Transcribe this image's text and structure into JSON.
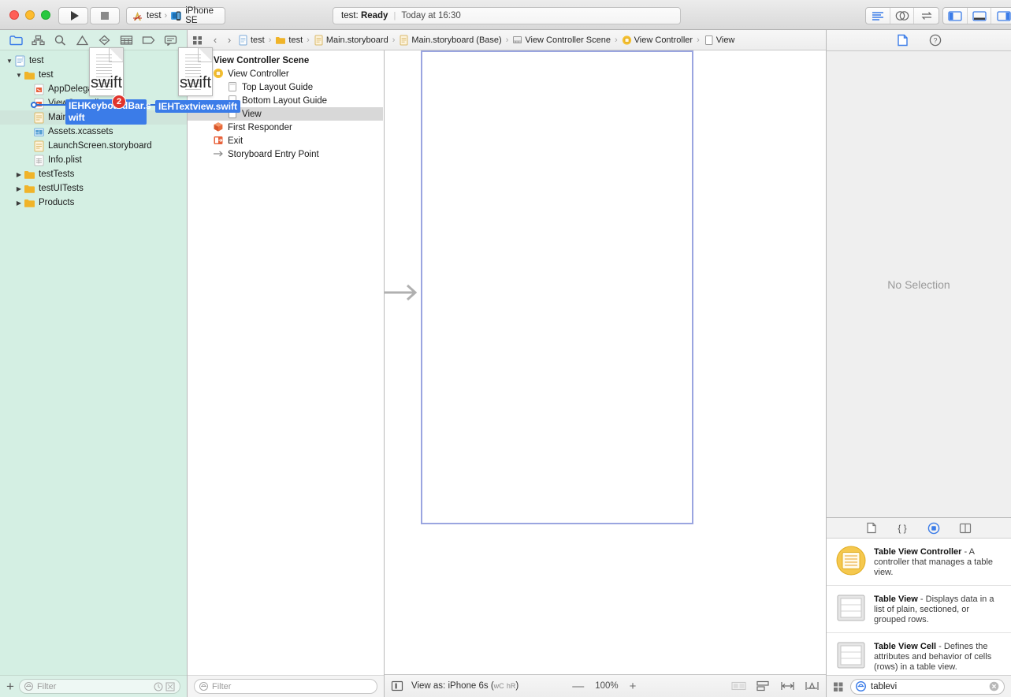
{
  "window": {
    "traffic_lights": [
      "close",
      "minimize",
      "zoom"
    ]
  },
  "toolbar": {
    "run_label": "Run",
    "stop_label": "Stop",
    "scheme_project": "test",
    "scheme_destination": "iPhone SE",
    "activity_prefix": "test:",
    "activity_status": "Ready",
    "activity_divider": "|",
    "activity_date": "Today at 16:30",
    "editor_modes": [
      "standard-editor",
      "assistant-editor",
      "version-editor"
    ],
    "panel_toggles": [
      "navigator-toggle",
      "debug-area-toggle",
      "utilities-toggle"
    ]
  },
  "navigator": {
    "tabs": [
      {
        "name": "project-navigator",
        "selected": true
      },
      {
        "name": "source-control-navigator",
        "selected": false
      },
      {
        "name": "symbol-navigator",
        "selected": false
      },
      {
        "name": "issue-navigator",
        "selected": false
      },
      {
        "name": "test-navigator",
        "selected": false
      },
      {
        "name": "debug-navigator",
        "selected": false
      },
      {
        "name": "breakpoint-navigator",
        "selected": false
      },
      {
        "name": "report-navigator",
        "selected": false
      }
    ],
    "tree": [
      {
        "label": "test",
        "indent": 0,
        "icon": "project",
        "twist": "open"
      },
      {
        "label": "test",
        "indent": 1,
        "icon": "folder",
        "twist": "open"
      },
      {
        "label": "AppDelegate.swift",
        "indent": 2,
        "icon": "swift",
        "twist": "none"
      },
      {
        "label": "ViewController.swift",
        "indent": 2,
        "icon": "swift",
        "twist": "none"
      },
      {
        "label": "Main.storyboard",
        "indent": 2,
        "icon": "storyboard",
        "twist": "none",
        "highlighted": true
      },
      {
        "label": "Assets.xcassets",
        "indent": 2,
        "icon": "assets",
        "twist": "none"
      },
      {
        "label": "LaunchScreen.storyboard",
        "indent": 2,
        "icon": "storyboard",
        "twist": "none"
      },
      {
        "label": "Info.plist",
        "indent": 2,
        "icon": "plist",
        "twist": "none"
      },
      {
        "label": "testTests",
        "indent": 1,
        "icon": "folder",
        "twist": "closed"
      },
      {
        "label": "testUITests",
        "indent": 1,
        "icon": "folder",
        "twist": "closed"
      },
      {
        "label": "Products",
        "indent": 1,
        "icon": "folder",
        "twist": "closed"
      }
    ],
    "add_button": "+",
    "filter_placeholder": "Filter"
  },
  "drag": {
    "files": [
      {
        "name": "IEHKeyboardBar.swift",
        "label_line1": "IEHKeyboardBar.s",
        "label_line2": "wift",
        "doc_type": "swift"
      },
      {
        "name": "IEHTextview.swift",
        "label_line1": "IEHTextview.swift",
        "label_line2": "",
        "doc_type": "swift"
      }
    ],
    "badge_count": "2"
  },
  "outline": {
    "rows": [
      {
        "label": "View Controller Scene",
        "indent": 0,
        "icon": "scene",
        "bold": true
      },
      {
        "label": "View Controller",
        "indent": 1,
        "icon": "view-controller"
      },
      {
        "label": "Top Layout Guide",
        "indent": 2,
        "icon": "layout-guide"
      },
      {
        "label": "Bottom Layout Guide",
        "indent": 2,
        "icon": "layout-guide"
      },
      {
        "label": "View",
        "indent": 2,
        "icon": "view",
        "selected": true
      },
      {
        "label": "First Responder",
        "indent": 1,
        "icon": "first-responder"
      },
      {
        "label": "Exit",
        "indent": 1,
        "icon": "exit"
      },
      {
        "label": "Storyboard Entry Point",
        "indent": 1,
        "icon": "entry-point"
      }
    ],
    "filter_placeholder": "Filter"
  },
  "jumpbar": {
    "back": "‹",
    "forward": "›",
    "crumbs": [
      {
        "label": "test",
        "icon": "project"
      },
      {
        "label": "test",
        "icon": "folder"
      },
      {
        "label": "Main.storyboard",
        "icon": "storyboard"
      },
      {
        "label": "Main.storyboard (Base)",
        "icon": "storyboard"
      },
      {
        "label": "View Controller Scene",
        "icon": "scene"
      },
      {
        "label": "View Controller",
        "icon": "view-controller"
      },
      {
        "label": "View",
        "icon": "view"
      }
    ],
    "separator": "›"
  },
  "canvas": {
    "device_toggle": "view-as-toggle",
    "view_as_prefix": "View as:",
    "view_as_device": "iPhone 6s",
    "size_class_w": "wC",
    "size_class_h": "hR",
    "zoom_out": "—",
    "zoom_value": "100%",
    "zoom_in": "+",
    "autolayout_buttons": [
      "update-frames",
      "embed-in",
      "align",
      "pin"
    ]
  },
  "inspector": {
    "tabs": [
      {
        "name": "file-inspector",
        "selected": true
      },
      {
        "name": "quick-help-inspector",
        "selected": false
      }
    ],
    "empty_state": "No Selection"
  },
  "library": {
    "tabs": [
      {
        "name": "file-template-library",
        "selected": false
      },
      {
        "name": "code-snippet-library",
        "selected": false
      },
      {
        "name": "object-library",
        "selected": true
      },
      {
        "name": "media-library",
        "selected": false
      }
    ],
    "items": [
      {
        "title": "Table View Controller",
        "dash": "-",
        "desc": "A controller that manages a table view.",
        "icon": "table-view-controller-icon"
      },
      {
        "title": "Table View",
        "dash": "-",
        "desc": "Displays data in a list of plain, sectioned, or grouped rows.",
        "icon": "table-view-icon"
      },
      {
        "title": "Table View Cell",
        "dash": "-",
        "desc": "Defines the attributes and behavior of cells (rows) in a table view.",
        "icon": "table-view-cell-icon"
      }
    ],
    "search_value": "tablevi",
    "view_mode_button": "grid-view-toggle",
    "clear_button": "clear-search"
  },
  "colors": {
    "accent_blue": "#3b7ce8",
    "badge_red": "#e0342c",
    "navigator_bg": "#d4efe3",
    "selection_gray": "#d8d8d8",
    "vc_border": "#9aa5e0",
    "yellow": "#f5c030"
  }
}
